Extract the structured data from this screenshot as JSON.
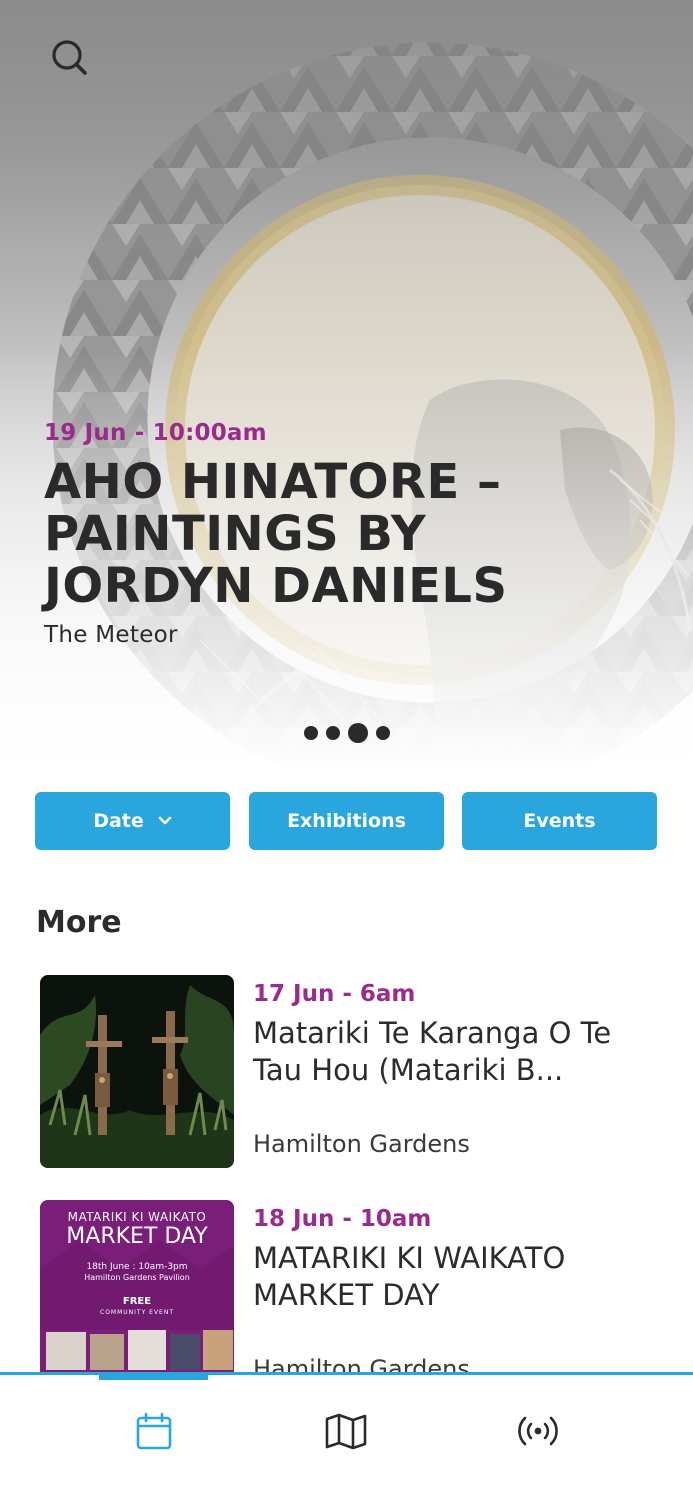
{
  "colors": {
    "accent": "#29a6de",
    "date_purple": "#9a2a8c",
    "text_dark": "#2b2b2b"
  },
  "hero": {
    "date": "19 Jun - 10:00am",
    "title": "AHO HINATORE – PAINTINGS BY JORDYN DANIELS",
    "venue": "The Meteor",
    "carousel": {
      "count": 4,
      "active_index": 2
    }
  },
  "filters": {
    "date_label": "Date",
    "exhibitions_label": "Exhibitions",
    "events_label": "Events"
  },
  "more": {
    "heading": "More",
    "items": [
      {
        "date": "17 Jun - 6am",
        "title": "Matariki Te Karanga O Te Tau Hou (Matariki B...",
        "venue": "Hamilton Gardens"
      },
      {
        "date": "18 Jun - 10am",
        "title": "MATARIKI KI WAIKATO MARKET DAY",
        "venue": "Hamilton Gardens",
        "poster": {
          "line1": "MATARIKI KI WAIKATO",
          "line2": "MARKET DAY",
          "line3": "18th June : 10am-3pm",
          "line4": "Hamilton Gardens Pavilion",
          "line5": "FREE",
          "line6": "COMMUNITY EVENT"
        }
      }
    ]
  },
  "tabbar": {
    "tabs": [
      {
        "icon": "calendar-icon",
        "active": true
      },
      {
        "icon": "map-icon",
        "active": false
      },
      {
        "icon": "broadcast-icon",
        "active": false
      }
    ]
  }
}
